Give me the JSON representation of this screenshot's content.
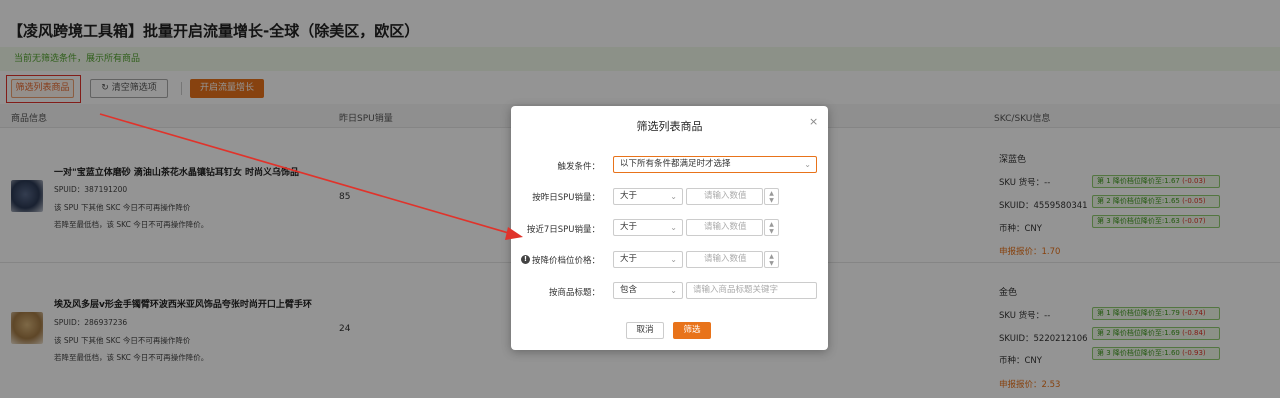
{
  "page_title": "【凌风跨境工具箱】批量开启流量增长-全球（除美区，欧区）",
  "notice": "当前无筛选条件，展示所有商品",
  "toolbar": {
    "filter_label": "筛选列表商品",
    "clear_label": "清空筛选项",
    "clear_icon": "↻",
    "start_label": "开启流量增长"
  },
  "table": {
    "headers": [
      "商品信息",
      "昨日SPU销量",
      "SKC/SKU信息"
    ]
  },
  "products": [
    {
      "name": "一对\"宝蓝立体磨砂 滴油山茶花水晶镶钻耳钉女 时尚义乌饰品",
      "spuid": "SPUID：387191200",
      "line1": "该 SPU 下其他 SKC 今日不可再操作降价",
      "line2": "若降至最低档，该 SKC 今日不可再操作降价。",
      "sales": "85",
      "color": "深蓝色",
      "sku_no": "SKU 货号：--",
      "skuid": "SKUID：4559580341",
      "currency": "币种：CNY",
      "report_price": "申报报价：1.70",
      "tags": [
        {
          "text": "第 1 降价档位降价至:1.67 ",
          "delta": "(-0.03)"
        },
        {
          "text": "第 2 降价档位降价至:1.65 ",
          "delta": "(-0.05)"
        },
        {
          "text": "第 3 降价档位降价至:1.63 ",
          "delta": "(-0.07)"
        }
      ]
    },
    {
      "name": "埃及风多层v形金手镯臂环波西米亚风饰品夸张时尚开口上臂手环",
      "spuid": "SPUID：286937236",
      "line1": "该 SPU 下其他 SKC 今日不可再操作降价",
      "line2": "若降至最低档，该 SKC 今日不可再操作降价。",
      "sales": "24",
      "color": "金色",
      "sku_no": "SKU 货号：--",
      "skuid": "SKUID：5220212106",
      "currency": "币种：CNY",
      "report_price": "申报报价：2.53",
      "tags": [
        {
          "text": "第 1 降价档位降价至:1.79 ",
          "delta": "(-0.74)"
        },
        {
          "text": "第 2 降价档位降价至:1.69 ",
          "delta": "(-0.84)"
        },
        {
          "text": "第 3 降价档位降价至:1.60 ",
          "delta": "(-0.93)"
        }
      ]
    }
  ],
  "modal": {
    "title": "筛选列表商品",
    "close_icon": "×",
    "trigger_label": "触发条件：",
    "trigger_value": "以下所有条件都满足时才选择",
    "yesterday_label": "按昨日SPU销量：",
    "yesterday_op": "大于",
    "week_label": "按近7日SPU销量：",
    "week_op": "大于",
    "price_label": "按降价档位价格：",
    "price_op": "大于",
    "title_label": "按商品标题：",
    "title_op": "包含",
    "num_placeholder": "请输入数值",
    "title_placeholder": "请输入商品标题关键字",
    "cancel_label": "取消",
    "ok_label": "筛选"
  },
  "colors": {
    "accent": "#e8731a",
    "annotation": "#e0332b",
    "success": "#3e9a1e"
  }
}
